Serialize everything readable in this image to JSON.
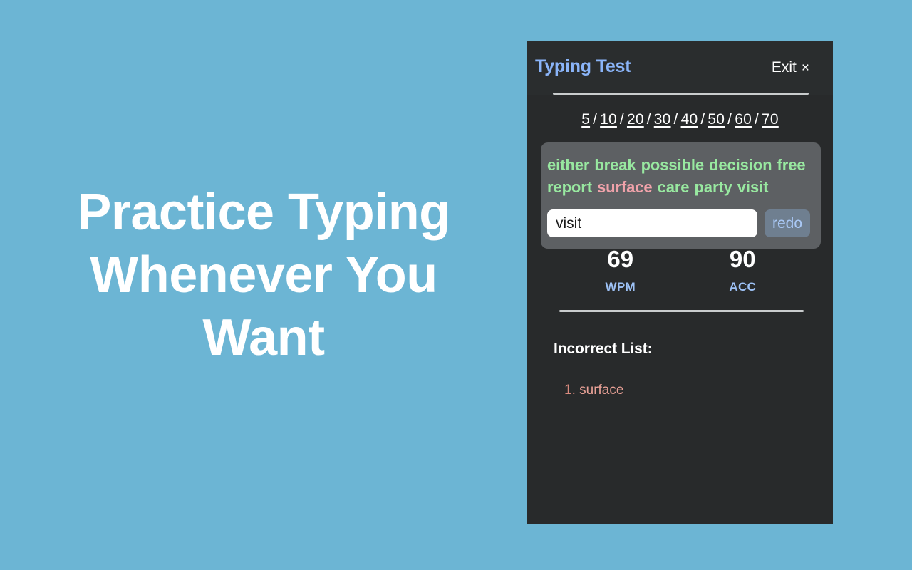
{
  "hero": {
    "headline": "Practice Typing Whenever You Want"
  },
  "panel": {
    "title": "Typing Test",
    "exit_label": "Exit",
    "exit_icon": "close-icon",
    "exit_glyph": "×"
  },
  "durations": {
    "options": [
      "5",
      "10",
      "20",
      "30",
      "40",
      "50",
      "60",
      "70"
    ],
    "separator": "/"
  },
  "word_test": {
    "words": [
      {
        "text": "either",
        "state": "correct"
      },
      {
        "text": "break",
        "state": "correct"
      },
      {
        "text": "possible",
        "state": "correct"
      },
      {
        "text": "decision",
        "state": "correct"
      },
      {
        "text": "free",
        "state": "correct"
      },
      {
        "text": "report",
        "state": "correct"
      },
      {
        "text": "surface",
        "state": "incorrect"
      },
      {
        "text": "care",
        "state": "correct"
      },
      {
        "text": "party",
        "state": "correct"
      },
      {
        "text": "visit",
        "state": "correct"
      }
    ],
    "input_value": "visit",
    "input_placeholder": "",
    "redo_label": "redo"
  },
  "stats": [
    {
      "value": "69",
      "label": "WPM"
    },
    {
      "value": "90",
      "label": "ACC"
    }
  ],
  "incorrect": {
    "title": "Incorrect List:",
    "items": [
      {
        "number": "1.",
        "word": "surface"
      }
    ]
  },
  "colors": {
    "page_background": "#6cb5d4",
    "panel_background": "#282a2b",
    "panel_header_background": "#2a2d2e",
    "title_accent": "#8ab4f8",
    "word_card_background": "#5d6063",
    "word_correct": "#98e8a0",
    "word_incorrect": "#f0a2aa",
    "redo_background": "#6f7f90",
    "redo_text": "#a9c8f5",
    "stat_label": "#9dc1f5",
    "incorrect_text": "#e8a096",
    "divider": "#c9cccd"
  }
}
